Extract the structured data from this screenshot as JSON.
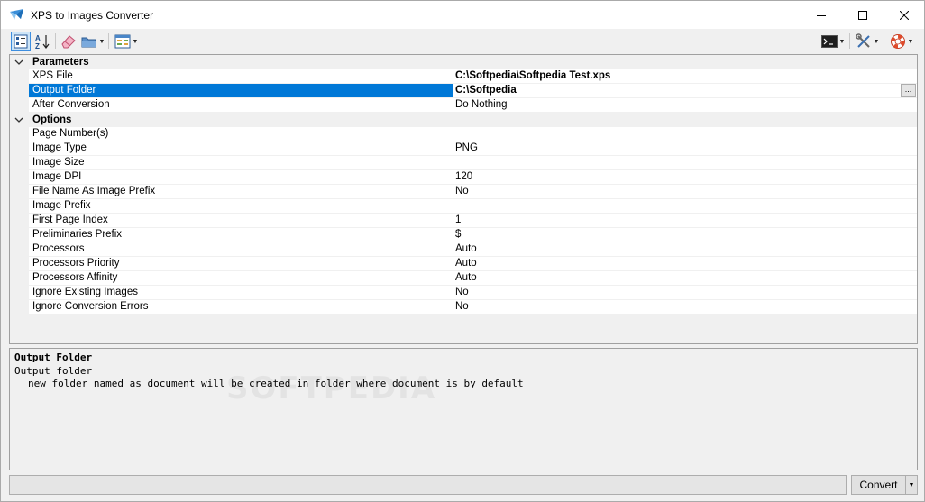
{
  "window": {
    "title": "XPS to Images Converter"
  },
  "toolbar": {
    "items": [
      {
        "icon": "categorized-icon",
        "active": true
      },
      {
        "icon": "alphabetical-sort-icon"
      },
      {
        "icon": "eraser-icon"
      },
      {
        "icon": "folder-open-icon"
      },
      {
        "icon": "property-pages-icon"
      },
      {
        "icon": "console-icon"
      },
      {
        "icon": "tools-icon"
      },
      {
        "icon": "help-lifebuoy-icon"
      }
    ]
  },
  "grid": {
    "parameters_label": "Parameters",
    "options_label": "Options",
    "parameters": [
      {
        "name": "XPS File",
        "value": "C:\\Softpedia\\Softpedia Test.xps",
        "bold": true
      },
      {
        "name": "Output Folder",
        "value": "C:\\Softpedia",
        "bold": true,
        "selected": true
      },
      {
        "name": "After Conversion",
        "value": "Do Nothing"
      }
    ],
    "options": [
      {
        "name": "Page Number(s)",
        "value": ""
      },
      {
        "name": "Image Type",
        "value": "PNG"
      },
      {
        "name": "Image Size",
        "value": ""
      },
      {
        "name": "Image DPI",
        "value": "120"
      },
      {
        "name": "File Name As Image Prefix",
        "value": "No"
      },
      {
        "name": "Image Prefix",
        "value": ""
      },
      {
        "name": "First Page Index",
        "value": "1"
      },
      {
        "name": "Preliminaries Prefix",
        "value": "$"
      },
      {
        "name": "Processors",
        "value": "Auto"
      },
      {
        "name": "Processors Priority",
        "value": "Auto"
      },
      {
        "name": "Processors Affinity",
        "value": "Auto"
      },
      {
        "name": "Ignore Existing Images",
        "value": "No"
      },
      {
        "name": "Ignore Conversion Errors",
        "value": "No"
      }
    ],
    "ellipsis_label": "..."
  },
  "description": {
    "title": "Output Folder",
    "subtitle": "Output folder",
    "text": "new folder named as document will be created in folder where document is by default",
    "watermark": "SOFTPEDIA"
  },
  "status": {
    "convert_label": "Convert"
  },
  "colors": {
    "selection": "#0078d7",
    "active_button": "#cce4f7"
  }
}
